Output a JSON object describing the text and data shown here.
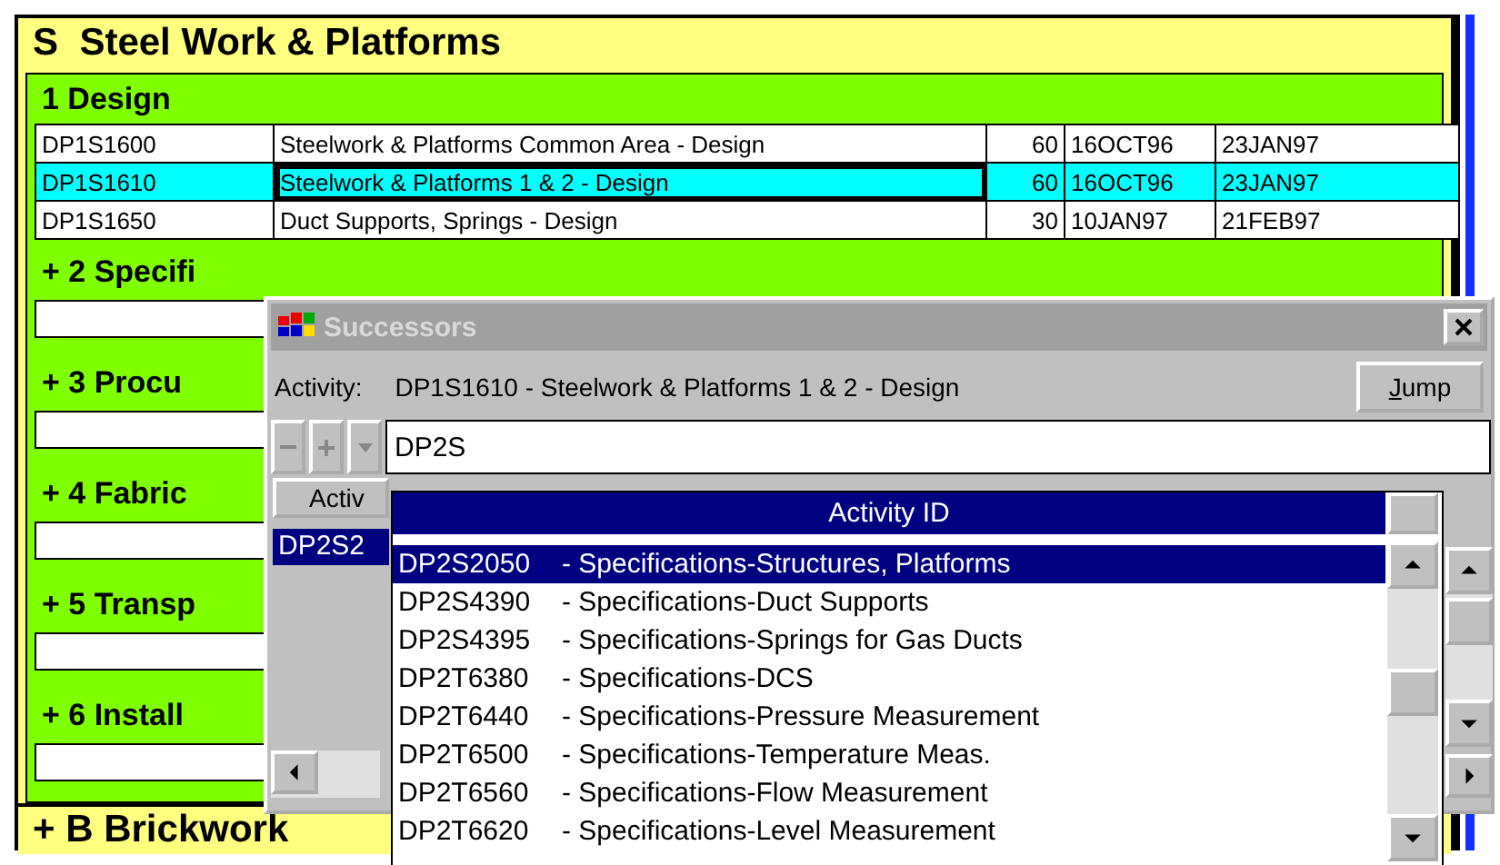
{
  "section": {
    "code": "S",
    "title": "Steel Work & Platforms"
  },
  "groups": [
    {
      "label": "1  Design",
      "expanded": true,
      "rows": [
        {
          "id": "DP1S1600",
          "description": "Steelwork & Platforms Common Area - Design",
          "duration": "60",
          "start": "16OCT96",
          "finish": "23JAN97",
          "selected": false
        },
        {
          "id": "DP1S1610",
          "description": "Steelwork & Platforms 1 & 2 - Design",
          "duration": "60",
          "start": "16OCT96",
          "finish": "23JAN97",
          "selected": true
        },
        {
          "id": "DP1S1650",
          "description": "Duct Supports, Springs - Design",
          "duration": "30",
          "start": "10JAN97",
          "finish": "21FEB97",
          "selected": false
        }
      ]
    },
    {
      "label": "+ 2  Specifi",
      "expanded": false
    },
    {
      "label": "+ 3  Procu",
      "expanded": false
    },
    {
      "label": "+ 4  Fabric",
      "expanded": false
    },
    {
      "label": "+ 5  Transp",
      "expanded": false
    },
    {
      "label": "+ 6  Install",
      "expanded": false
    }
  ],
  "next_section": "+ B  Brickwork",
  "dialog": {
    "title": "Successors",
    "active": false,
    "activity_label": "Activity:",
    "activity_value": "DP1S1610 - Steelwork & Platforms 1 & 2 - Design",
    "jump_button": "Jump",
    "filter": {
      "value": "DP2S"
    },
    "grid": {
      "column": "Activ",
      "rows": [
        {
          "id": "DP2S2",
          "selected": true
        }
      ]
    },
    "dropdown": {
      "header": "Activity ID",
      "items": [
        {
          "id": "DP2S2050",
          "description": "- Specifications-Structures, Platforms",
          "selected": true
        },
        {
          "id": "DP2S4390",
          "description": "- Specifications-Duct Supports",
          "selected": false
        },
        {
          "id": "DP2S4395",
          "description": "- Specifications-Springs for Gas Ducts",
          "selected": false
        },
        {
          "id": "DP2T6380",
          "description": "- Specifications-DCS",
          "selected": false
        },
        {
          "id": "DP2T6440",
          "description": "- Specifications-Pressure Measurement",
          "selected": false
        },
        {
          "id": "DP2T6500",
          "description": "- Specifications-Temperature Meas.",
          "selected": false
        },
        {
          "id": "DP2T6560",
          "description": "- Specifications-Flow Measurement",
          "selected": false
        },
        {
          "id": "DP2T6620",
          "description": "- Specifications-Level Measurement",
          "selected": false
        }
      ]
    }
  }
}
